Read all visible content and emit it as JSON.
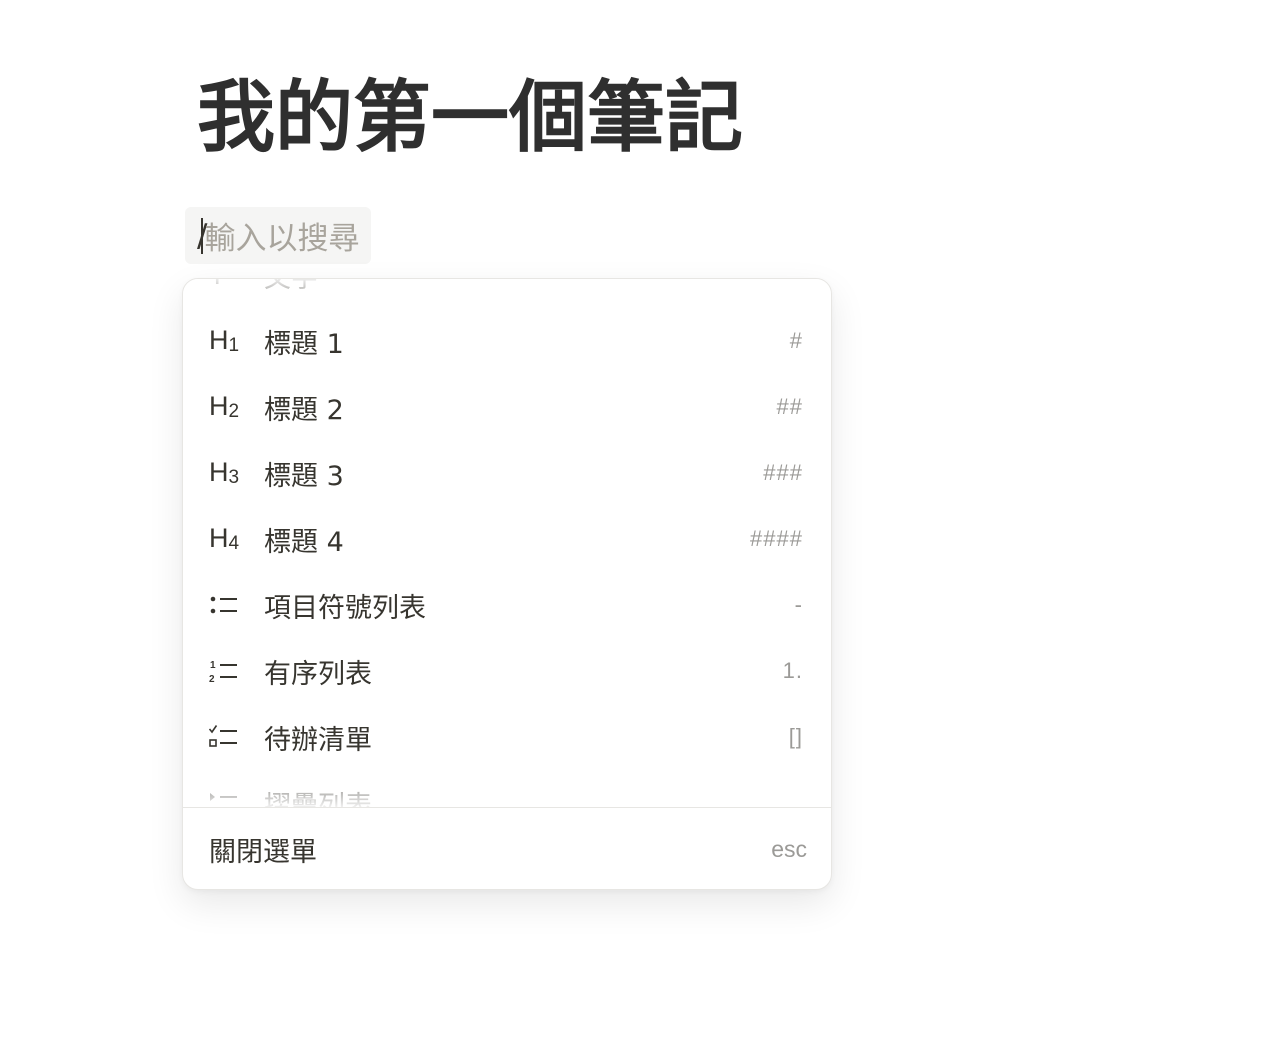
{
  "page": {
    "title": "我的第一個筆記"
  },
  "slash_command": {
    "typed": "/",
    "placeholder": "輸入以搜尋"
  },
  "menu": {
    "items": [
      {
        "icon": "text-icon",
        "icon_text": "T",
        "label": "文字",
        "shortcut": ""
      },
      {
        "icon": "heading-1-icon",
        "icon_text": "H",
        "icon_sub": "1",
        "label": "標題 1",
        "shortcut": "#"
      },
      {
        "icon": "heading-2-icon",
        "icon_text": "H",
        "icon_sub": "2",
        "label": "標題 2",
        "shortcut": "##"
      },
      {
        "icon": "heading-3-icon",
        "icon_text": "H",
        "icon_sub": "3",
        "label": "標題 3",
        "shortcut": "###"
      },
      {
        "icon": "heading-4-icon",
        "icon_text": "H",
        "icon_sub": "4",
        "label": "標題 4",
        "shortcut": "####"
      },
      {
        "icon": "bulleted-list-icon",
        "label": "項目符號列表",
        "shortcut": "-"
      },
      {
        "icon": "numbered-list-icon",
        "label": "有序列表",
        "shortcut": "1."
      },
      {
        "icon": "todo-list-icon",
        "label": "待辦清單",
        "shortcut": "[]"
      },
      {
        "icon": "toggle-list-icon",
        "label": "摺疊列表",
        "shortcut": ""
      }
    ],
    "footer": {
      "close_label": "關閉選單",
      "close_shortcut": "esc"
    }
  }
}
